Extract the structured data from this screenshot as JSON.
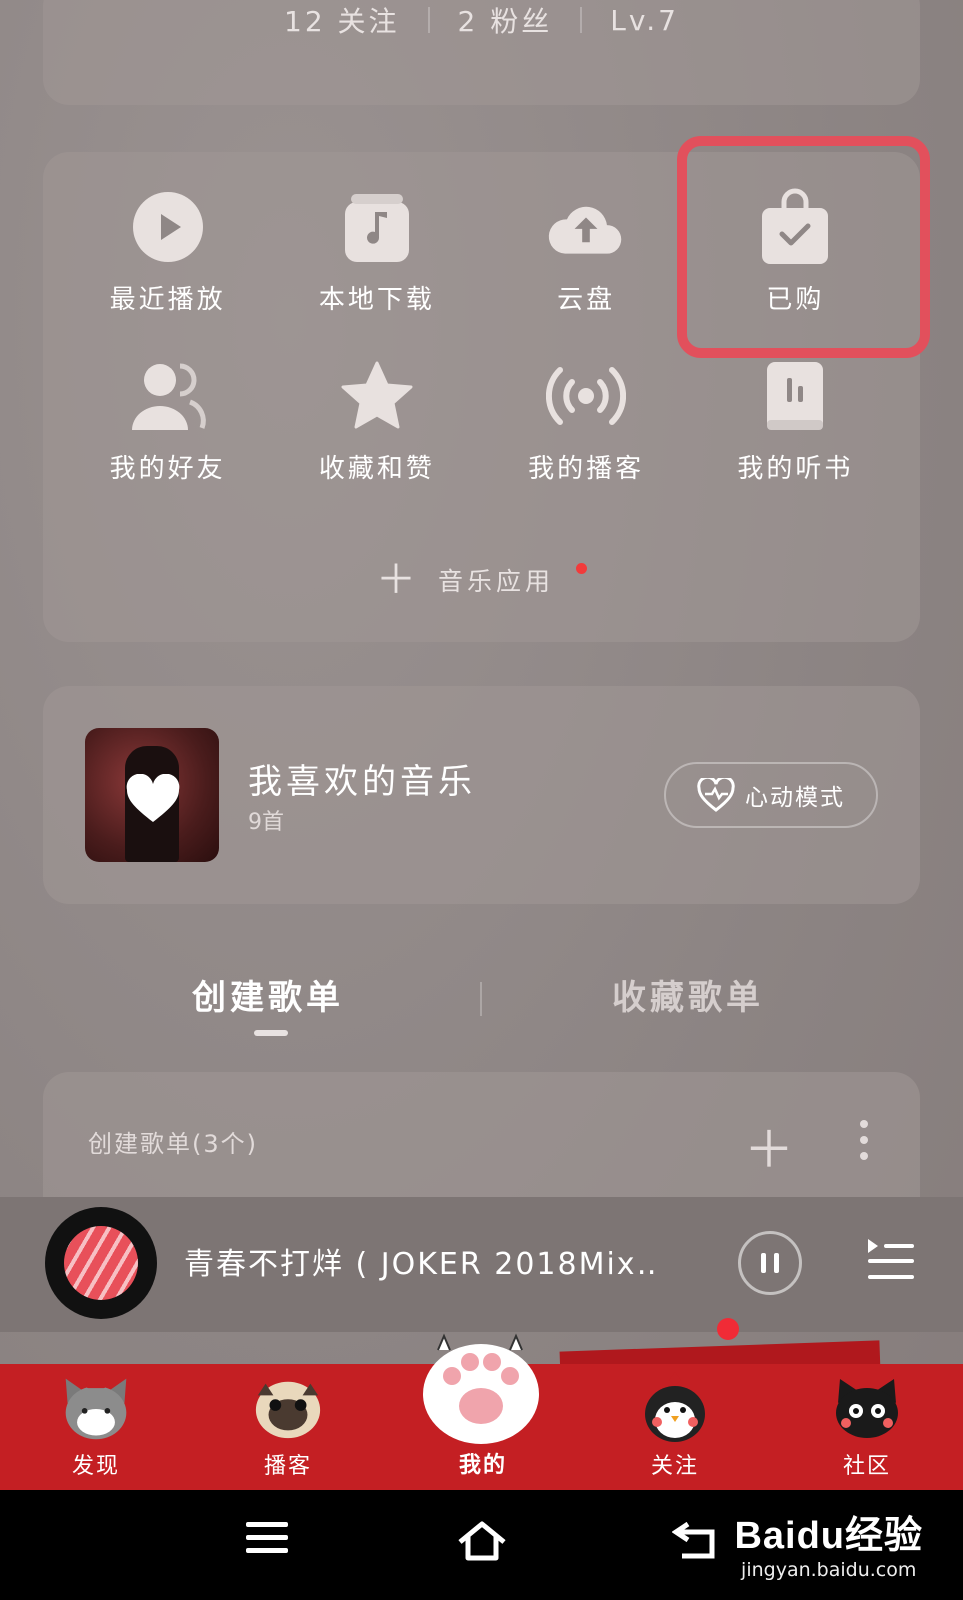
{
  "stats": {
    "following": "12 关注",
    "fans": "2 粉丝",
    "level": "Lv.7"
  },
  "grid": [
    {
      "label": "最近播放",
      "icon": "play-circle-icon"
    },
    {
      "label": "本地下载",
      "icon": "music-note-icon"
    },
    {
      "label": "云盘",
      "icon": "cloud-upload-icon"
    },
    {
      "label": "已购",
      "icon": "shopping-bag-check-icon"
    },
    {
      "label": "我的好友",
      "icon": "friends-icon"
    },
    {
      "label": "收藏和赞",
      "icon": "star-icon"
    },
    {
      "label": "我的播客",
      "icon": "broadcast-icon"
    },
    {
      "label": "我的听书",
      "icon": "audiobook-icon"
    }
  ],
  "music_app": {
    "label": "音乐应用"
  },
  "liked": {
    "title": "我喜欢的音乐",
    "count": "9首",
    "heart_mode": "心动模式"
  },
  "tabs": {
    "created": "创建歌单",
    "favorites": "收藏歌单"
  },
  "playlist_section": {
    "title": "创建歌单(3个)"
  },
  "player": {
    "song": "青春不打烊 ( JOKER 2018Mix…"
  },
  "nav": [
    {
      "label": "发现"
    },
    {
      "label": "播客"
    },
    {
      "label": "我的"
    },
    {
      "label": "关注"
    },
    {
      "label": "社区"
    }
  ],
  "watermark": {
    "logo": "Baidu经验",
    "url": "jingyan.baidu.com"
  },
  "colors": {
    "highlight": "#e2505c",
    "nav_red": "#c41f23",
    "notification_dot": "#f23b3b"
  }
}
